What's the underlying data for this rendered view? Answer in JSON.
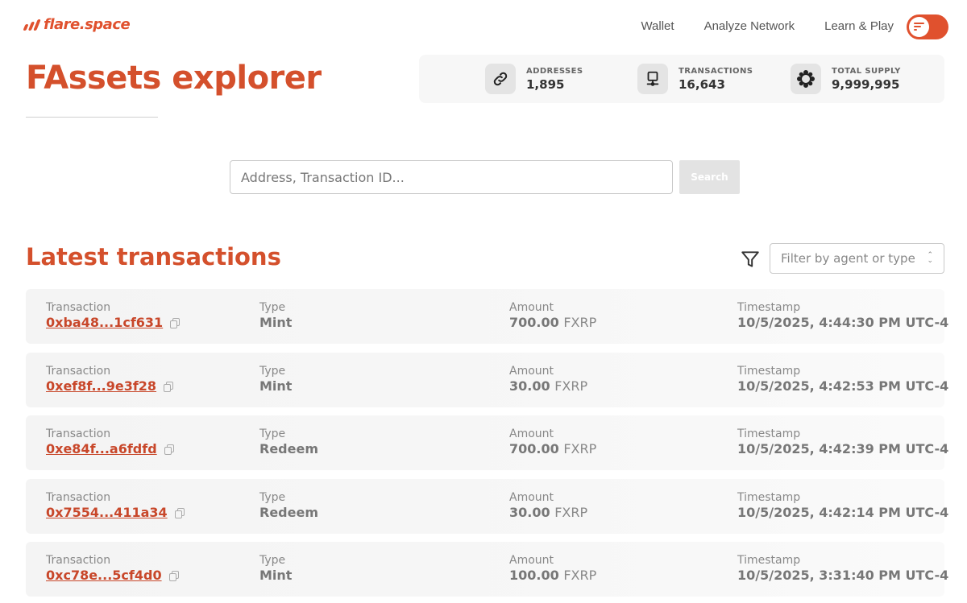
{
  "header": {
    "logo_text": "flare.space",
    "nav": [
      "Wallet",
      "Analyze Network",
      "Learn & Play"
    ]
  },
  "hero": {
    "title": "FAssets explorer"
  },
  "stats": [
    {
      "label": "ADDRESSES",
      "value": "1,895",
      "icon": "link-icon"
    },
    {
      "label": "TRANSACTIONS",
      "value": "16,643",
      "icon": "transaction-icon"
    },
    {
      "label": "TOTAL SUPPLY",
      "value": "9,999,995",
      "icon": "supply-icon"
    }
  ],
  "search": {
    "placeholder": "Address, Transaction ID...",
    "button_label": "Search"
  },
  "latest": {
    "title": "Latest transactions",
    "filter_placeholder": "Filter by agent or type"
  },
  "columns": {
    "transaction": "Transaction",
    "type": "Type",
    "amount": "Amount",
    "timestamp": "Timestamp"
  },
  "transactions": [
    {
      "id": "0xba48...1cf631",
      "type": "Mint",
      "amount": "700.00",
      "unit": "FXRP",
      "timestamp": "10/5/2025, 4:44:30 PM UTC-4"
    },
    {
      "id": "0xef8f...9e3f28",
      "type": "Mint",
      "amount": "30.00",
      "unit": "FXRP",
      "timestamp": "10/5/2025, 4:42:53 PM UTC-4"
    },
    {
      "id": "0xe84f...a6fdfd",
      "type": "Redeem",
      "amount": "700.00",
      "unit": "FXRP",
      "timestamp": "10/5/2025, 4:42:39 PM UTC-4"
    },
    {
      "id": "0x7554...411a34",
      "type": "Redeem",
      "amount": "30.00",
      "unit": "FXRP",
      "timestamp": "10/5/2025, 4:42:14 PM UTC-4"
    },
    {
      "id": "0xc78e...5cf4d0",
      "type": "Mint",
      "amount": "100.00",
      "unit": "FXRP",
      "timestamp": "10/5/2025, 3:31:40 PM UTC-4"
    }
  ],
  "colors": {
    "brand": "#e0512e",
    "title": "#d4502c",
    "link": "#c8472a"
  }
}
